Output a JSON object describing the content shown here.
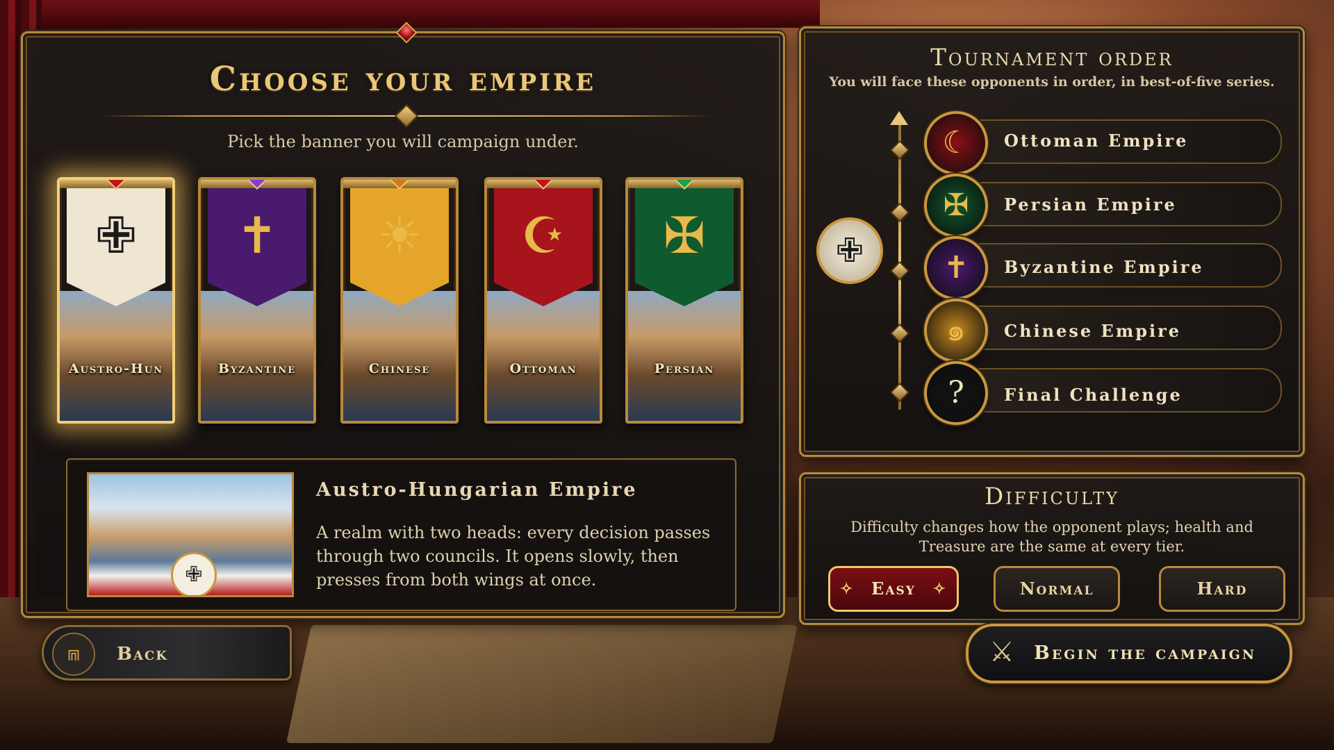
{
  "left_panel": {
    "title": "Choose your empire",
    "subtitle": "Pick the banner you will campaign under."
  },
  "banners": [
    {
      "label": "Austro-Hun",
      "cloth_color": "#efe6d2",
      "gem_color": "#c8101c",
      "emblem_icon": "double-headed-eagle-icon",
      "selected": true
    },
    {
      "label": "Byzantine",
      "cloth_color": "#4a1a6e",
      "gem_color": "#8a3ad0",
      "emblem_icon": "cross-eagle-icon",
      "selected": false
    },
    {
      "label": "Chinese",
      "cloth_color": "#e5a52a",
      "gem_color": "#d07a1a",
      "emblem_icon": "dragon-icon",
      "selected": false
    },
    {
      "label": "Ottoman",
      "cloth_color": "#a8141c",
      "gem_color": "#c8101c",
      "emblem_icon": "crescent-tughra-icon",
      "selected": false
    },
    {
      "label": "Persian",
      "cloth_color": "#0f5a2e",
      "gem_color": "#1aa050",
      "emblem_icon": "faravahar-icon",
      "selected": false
    }
  ],
  "selected_empire": {
    "name": "Austro-Hungarian Empire",
    "description": "A realm with two heads: every decision passes through two councils. It opens slowly, then presses from both wings at once."
  },
  "back_button": {
    "label": "Back",
    "icon": "castle-gate-icon"
  },
  "tournament": {
    "title": "Tournament order",
    "subtitle": "You will face these opponents in order, in best-of-five series.",
    "player_icon": "double-headed-eagle-icon",
    "opponents": [
      {
        "name": "Ottoman Empire",
        "icon": "crescent-tughra-icon",
        "color": "#8a1016",
        "glyph": "☾"
      },
      {
        "name": "Persian Empire",
        "icon": "faravahar-icon",
        "color": "#0f5a2e",
        "glyph": "✠"
      },
      {
        "name": "Byzantine Empire",
        "icon": "cross-eagle-icon",
        "color": "#4a1a6e",
        "glyph": "✝"
      },
      {
        "name": "Chinese Empire",
        "icon": "dragon-icon",
        "color": "#c88a1e",
        "glyph": "๑"
      },
      {
        "name": "Final Challenge",
        "icon": "question-mark-icon",
        "color": "#141414",
        "glyph": "?"
      }
    ]
  },
  "difficulty": {
    "title": "Difficulty",
    "description": "Difficulty changes how the opponent plays; health and Treasure are the same at every tier.",
    "options": [
      "Easy",
      "Normal",
      "Hard"
    ],
    "selected": "Easy"
  },
  "begin_button": {
    "label": "Begin the campaign",
    "icon": "crossed-axes-icon"
  }
}
